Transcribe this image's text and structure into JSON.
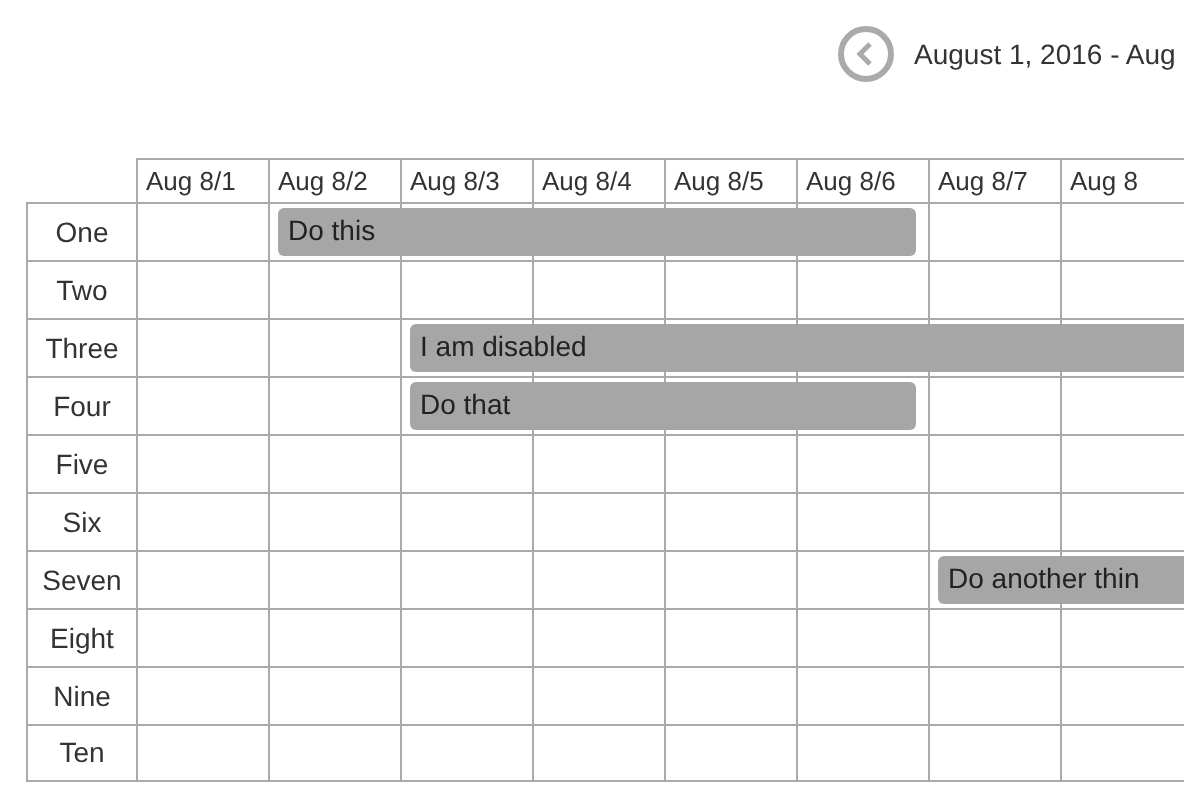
{
  "header": {
    "date_range": "August 1, 2016 - Aug"
  },
  "days": [
    "Aug 8/1",
    "Aug 8/2",
    "Aug 8/3",
    "Aug 8/4",
    "Aug 8/5",
    "Aug 8/6",
    "Aug 8/7",
    "Aug 8"
  ],
  "rows": [
    {
      "label": "One",
      "slots": [
        {
          "kind": "empty"
        },
        {
          "kind": "event",
          "text": "Do this"
        },
        {
          "kind": "continued"
        },
        {
          "kind": "continued"
        },
        {
          "kind": "continued"
        },
        {
          "kind": "continued"
        },
        {
          "kind": "empty"
        },
        {
          "kind": "empty"
        }
      ]
    },
    {
      "label": "Two",
      "slots": []
    },
    {
      "label": "Three",
      "slots": [
        {
          "kind": "empty"
        },
        {
          "kind": "empty"
        },
        {
          "kind": "event",
          "text": "I am disabled"
        },
        {
          "kind": "continued"
        },
        {
          "kind": "continued"
        },
        {
          "kind": "continued"
        },
        {
          "kind": "continued"
        },
        {
          "kind": "continued"
        }
      ]
    },
    {
      "label": "Four",
      "slots": [
        {
          "kind": "empty"
        },
        {
          "kind": "empty"
        },
        {
          "kind": "event",
          "text": "Do that"
        },
        {
          "kind": "continued"
        },
        {
          "kind": "continued"
        },
        {
          "kind": "continued"
        },
        {
          "kind": "empty"
        },
        {
          "kind": "empty"
        }
      ]
    },
    {
      "label": "Five",
      "slots": []
    },
    {
      "label": "Six",
      "slots": []
    },
    {
      "label": "Seven",
      "slots": [
        {
          "kind": "empty"
        },
        {
          "kind": "empty"
        },
        {
          "kind": "empty"
        },
        {
          "kind": "empty"
        },
        {
          "kind": "empty"
        },
        {
          "kind": "empty"
        },
        {
          "kind": "event",
          "text": "Do another thin"
        },
        {
          "kind": "continued"
        }
      ]
    },
    {
      "label": "Eight",
      "slots": []
    },
    {
      "label": "Nine",
      "slots": []
    },
    {
      "label": "Ten",
      "slots": []
    }
  ]
}
